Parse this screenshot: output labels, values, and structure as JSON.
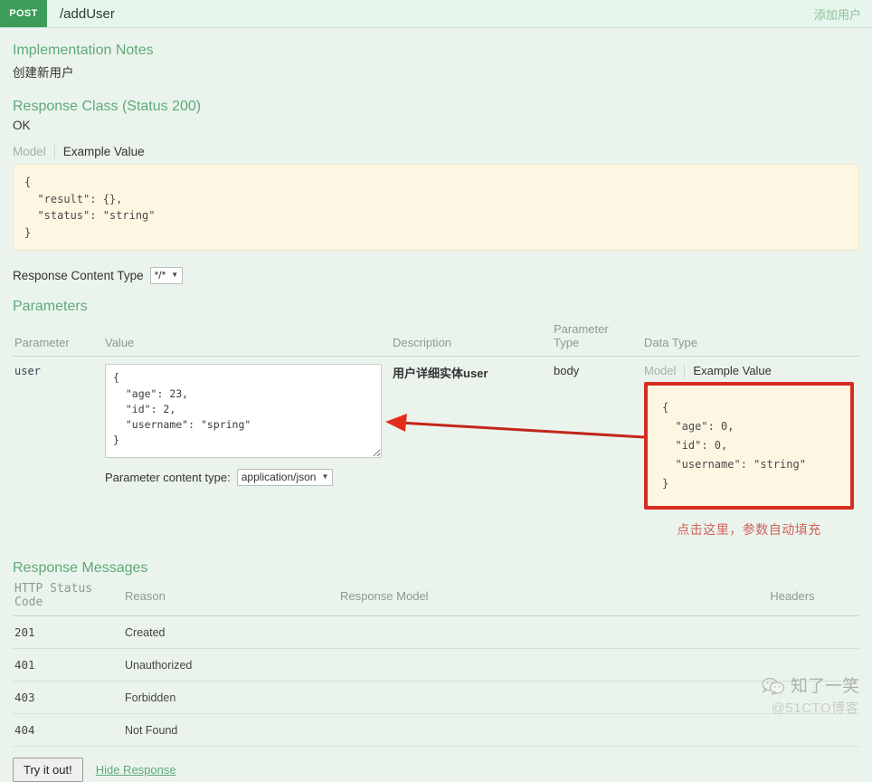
{
  "operation": {
    "method": "POST",
    "path": "/addUser",
    "summary": "添加用户"
  },
  "implementation_notes": {
    "heading": "Implementation Notes",
    "text": "创建新用户"
  },
  "response_class": {
    "heading": "Response Class (Status 200)",
    "status_text": "OK",
    "tabs": {
      "model": "Model",
      "example_value": "Example Value"
    },
    "example_json": "{\n  \"result\": {},\n  \"status\": \"string\"\n}"
  },
  "response_content_type": {
    "label": "Response Content Type",
    "value": "*/*",
    "caret": "chevron-down-icon"
  },
  "parameters": {
    "heading": "Parameters",
    "columns": {
      "parameter": "Parameter",
      "value": "Value",
      "description": "Description",
      "parameter_type": "Parameter\nType",
      "data_type": "Data Type"
    },
    "rows": [
      {
        "name": "user",
        "value": "{\n  \"age\": 23,\n  \"id\": 2,\n  \"username\": \"spring\"\n}",
        "description": "用户详细实体user",
        "parameter_type": "body",
        "data_type_tabs": {
          "model": "Model",
          "example_value": "Example Value"
        },
        "data_type_example": "{\n  \"age\": 0,\n  \"id\": 0,\n  \"username\": \"string\"\n}"
      }
    ],
    "content_type": {
      "label": "Parameter content type:",
      "value": "application/json",
      "caret": "chevron-down-icon"
    }
  },
  "annotation": {
    "note": "点击这里，参数自动填充",
    "box_color": "#d82c20",
    "text_color": "#d1615a",
    "arrow": "left-arrow-annotation"
  },
  "response_messages": {
    "heading": "Response Messages",
    "columns": {
      "status_code": "HTTP Status Code",
      "reason": "Reason",
      "response_model": "Response Model",
      "headers": "Headers"
    },
    "rows": [
      {
        "code": "201",
        "reason": "Created",
        "model": "",
        "headers": ""
      },
      {
        "code": "401",
        "reason": "Unauthorized",
        "model": "",
        "headers": ""
      },
      {
        "code": "403",
        "reason": "Forbidden",
        "model": "",
        "headers": ""
      },
      {
        "code": "404",
        "reason": "Not Found",
        "model": "",
        "headers": ""
      }
    ]
  },
  "footer": {
    "try_it_out": "Try it out!",
    "hide_response": "Hide Response"
  },
  "watermark": {
    "icon": "wechat-icon",
    "name": "知了一笑",
    "source": "@51CTO博客"
  }
}
